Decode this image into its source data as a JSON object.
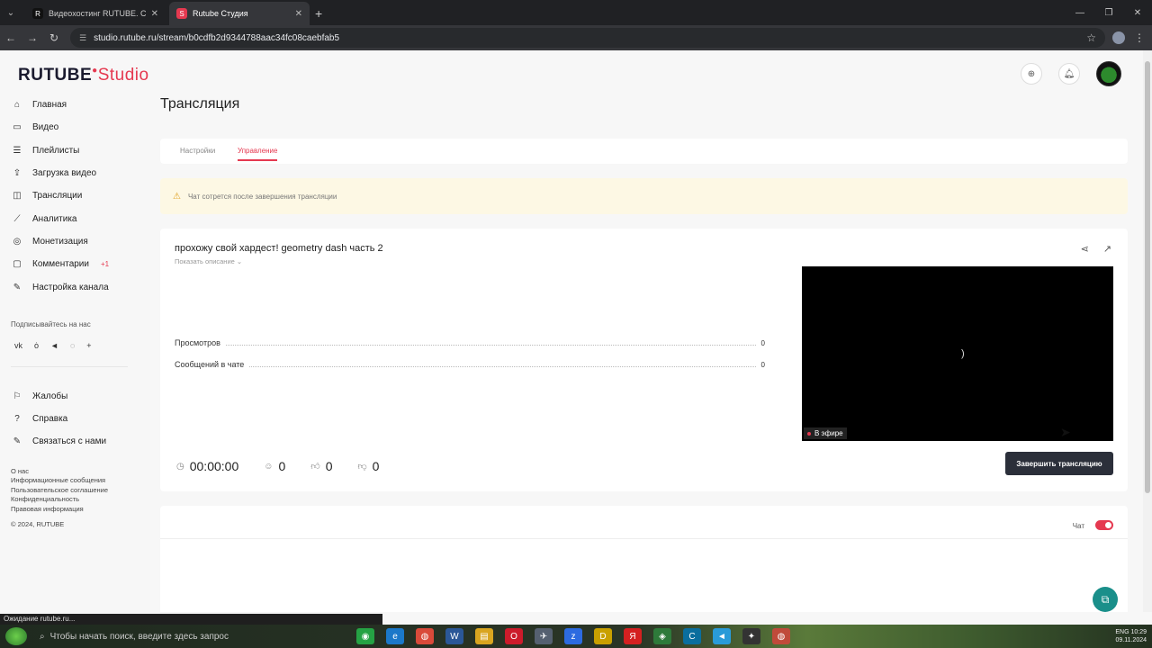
{
  "browser": {
    "tabs": [
      {
        "favicon": "R",
        "label": "Видеохостинг RUTUBE. Смотр…",
        "active": false
      },
      {
        "favicon": "S",
        "label": "Rutube Студия",
        "active": true
      }
    ],
    "url": "studio.rutube.ru/stream/b0cdfb2d9344788aac34fc08caebfab5",
    "status": "Ожидание rutube.ru..."
  },
  "logo": {
    "brand": "RUTUBE",
    "product": "Studio"
  },
  "sidebar": {
    "nav": [
      {
        "icon": "home-icon",
        "glyph": "⌂",
        "label": "Главная",
        "badge": ""
      },
      {
        "icon": "video-icon",
        "glyph": "▭",
        "label": "Видео",
        "badge": ""
      },
      {
        "icon": "playlist-icon",
        "glyph": "☰",
        "label": "Плейлисты",
        "badge": ""
      },
      {
        "icon": "upload-icon",
        "glyph": "⇪",
        "label": "Загрузка видео",
        "badge": ""
      },
      {
        "icon": "broadcast-icon",
        "glyph": "◫",
        "label": "Трансляции",
        "badge": ""
      },
      {
        "icon": "analytics-icon",
        "glyph": "⟋",
        "label": "Аналитика",
        "badge": ""
      },
      {
        "icon": "monetization-icon",
        "glyph": "◎",
        "label": "Монетизация",
        "badge": ""
      },
      {
        "icon": "comments-icon",
        "glyph": "▢",
        "label": "Комментарии",
        "badge": "+1"
      },
      {
        "icon": "channel-settings-icon",
        "glyph": "✎",
        "label": "Настройка канала",
        "badge": ""
      }
    ],
    "follow_label": "Подписывайтесь на нас",
    "socials": [
      {
        "icon": "vk-icon",
        "glyph": "vk"
      },
      {
        "icon": "ok-icon",
        "glyph": "ȯ"
      },
      {
        "icon": "telegram-icon",
        "glyph": "◄"
      },
      {
        "icon": "viber-icon",
        "glyph": "◌"
      },
      {
        "icon": "more-icon",
        "glyph": "+"
      }
    ],
    "secondary": [
      {
        "icon": "report-icon",
        "glyph": "⚐",
        "label": "Жалобы"
      },
      {
        "icon": "help-icon",
        "glyph": "?",
        "label": "Справка"
      },
      {
        "icon": "contact-icon",
        "glyph": "✎",
        "label": "Связаться с нами"
      }
    ],
    "footer_links": [
      "О нас",
      "Информационные сообщения",
      "Пользовательское соглашение",
      "Конфиденциальность",
      "Правовая информация"
    ],
    "copyright": "© 2024, RUTUBE"
  },
  "page": {
    "title": "Трансляция",
    "tabs": [
      {
        "label": "Настройки",
        "active": false
      },
      {
        "label": "Управление",
        "active": true
      }
    ],
    "warning": "Чат сотрется после завершения трансляции"
  },
  "stream": {
    "title": "прохожу свой хардест! geometry dash часть 2",
    "show_description": "Показать описание",
    "stats": [
      {
        "label": "Просмотров",
        "value": "0"
      },
      {
        "label": "Сообщений в чате",
        "value": "0"
      }
    ],
    "live_label": "В эфире",
    "spinner": ")",
    "metrics": {
      "duration": "00:00:00",
      "viewers": "0",
      "likes": "0",
      "dislikes": "0"
    },
    "end_button": "Завершить трансляцию"
  },
  "chat": {
    "label": "Чат",
    "enabled": true
  },
  "taskbar": {
    "search_placeholder": "Чтобы начать поиск, введите здесь запрос",
    "apps": [
      {
        "icon": "whatsapp-icon",
        "color": "#25a244",
        "glyph": "◉"
      },
      {
        "icon": "edge-icon",
        "color": "#1b78c9",
        "glyph": "e"
      },
      {
        "icon": "chrome-icon",
        "color": "#d94a3a",
        "glyph": "◍"
      },
      {
        "icon": "word-icon",
        "color": "#2b5797",
        "glyph": "W"
      },
      {
        "icon": "explorer-icon",
        "color": "#d9a520",
        "glyph": "▤"
      },
      {
        "icon": "opera-icon",
        "color": "#cc1b2b",
        "glyph": "O"
      },
      {
        "icon": "app-icon",
        "color": "#556070",
        "glyph": "✈"
      },
      {
        "icon": "zoom-icon",
        "color": "#2d6be0",
        "glyph": "z"
      },
      {
        "icon": "app2-icon",
        "color": "#c9a000",
        "glyph": "D"
      },
      {
        "icon": "yandex-icon",
        "color": "#d42020",
        "glyph": "Я"
      },
      {
        "icon": "app3-icon",
        "color": "#2e7a3a",
        "glyph": "◈"
      },
      {
        "icon": "app4-icon",
        "color": "#0a6e9e",
        "glyph": "C"
      },
      {
        "icon": "telegram-icon",
        "color": "#2a9bd8",
        "glyph": "◄"
      },
      {
        "icon": "app5-icon",
        "color": "#333333",
        "glyph": "✦"
      },
      {
        "icon": "chrome2-icon",
        "color": "#c04a3a",
        "glyph": "◍"
      }
    ],
    "tray_line1": "ENG 10:29",
    "tray_line2": "09.11.2024"
  }
}
